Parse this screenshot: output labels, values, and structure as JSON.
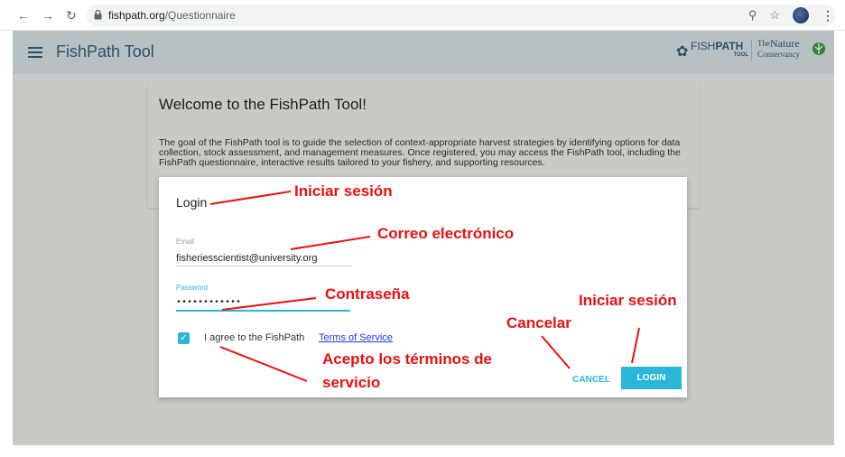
{
  "browser": {
    "url_domain": "fishpath.org",
    "url_path": "/Questionnaire",
    "back_icon": "arrow-left",
    "forward_icon": "arrow-right",
    "reload_icon": "reload"
  },
  "app": {
    "title": "FishPath Tool",
    "logo_fishpath_a": "FISH",
    "logo_fishpath_b": "PATH",
    "logo_fishpath_sub": "TOOL",
    "logo_tnc_the": "The",
    "logo_tnc_nature": "Nature",
    "logo_tnc_cons": "Conservancy"
  },
  "welcome": {
    "title": "Welcome to the FishPath Tool!",
    "body": "The goal of the FishPath tool is to guide the selection of context-appropriate harvest strategies by identifying options for data collection, stock assessment, and management measures. Once registered, you may access the FishPath tool, including the FishPath questionnaire, interactive results tailored to your fishery, and supporting resources."
  },
  "login": {
    "title": "Login",
    "email_label": "Email",
    "email_value": "fisheriesscientist@university.org",
    "password_label": "Password",
    "password_value": "••••••••••••",
    "agree_text": "I agree to the FishPath",
    "tos_link": "Terms of Service",
    "checkbox_checked": true,
    "cancel_label": "CANCEL",
    "login_label": "LOGIN"
  },
  "annotations": {
    "login": "Iniciar sesión",
    "email": "Correo electrónico",
    "password": "Contraseña",
    "cancel": "Cancelar",
    "login_button": "Iniciar sesión",
    "terms_line1": "Acepto los términos de",
    "terms_line2": "servicio",
    "color": "#e8110f"
  }
}
